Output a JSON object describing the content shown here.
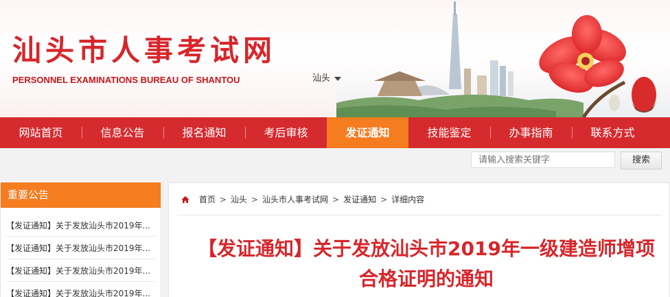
{
  "header": {
    "title": "汕头市人事考试网",
    "subtitle": "PERSONNEL EXAMINATIONS BUREAU OF SHANTOU",
    "city_selector": "汕头"
  },
  "nav": {
    "items": [
      {
        "label": "网站首页"
      },
      {
        "label": "信息公告"
      },
      {
        "label": "报名通知"
      },
      {
        "label": "考后审核"
      },
      {
        "label": "发证通知",
        "active": true
      },
      {
        "label": "技能鉴定"
      },
      {
        "label": "办事指南"
      },
      {
        "label": "联系方式"
      }
    ]
  },
  "search": {
    "placeholder": "请输入搜索关键字",
    "button": "搜索"
  },
  "sidebar": {
    "heading": "重要公告",
    "notices": [
      "【发证通知】关于发放汕头市2019年...",
      "【发证通知】关于发放汕头市2019年...",
      "【发证通知】关于发放汕头市2019年...",
      "【发证通知】关于发放汕头市2019年..."
    ]
  },
  "breadcrumb": [
    "首页",
    "汕头",
    "汕头市人事考试网",
    "发证通知",
    "详细内容"
  ],
  "article": {
    "title": "【发证通知】关于发放汕头市2019年一级建造师增项合格证明的通知"
  },
  "colors": {
    "brand_red": "#d52b2f",
    "active_orange": "#f57c1f",
    "title_red": "#d7262b"
  }
}
